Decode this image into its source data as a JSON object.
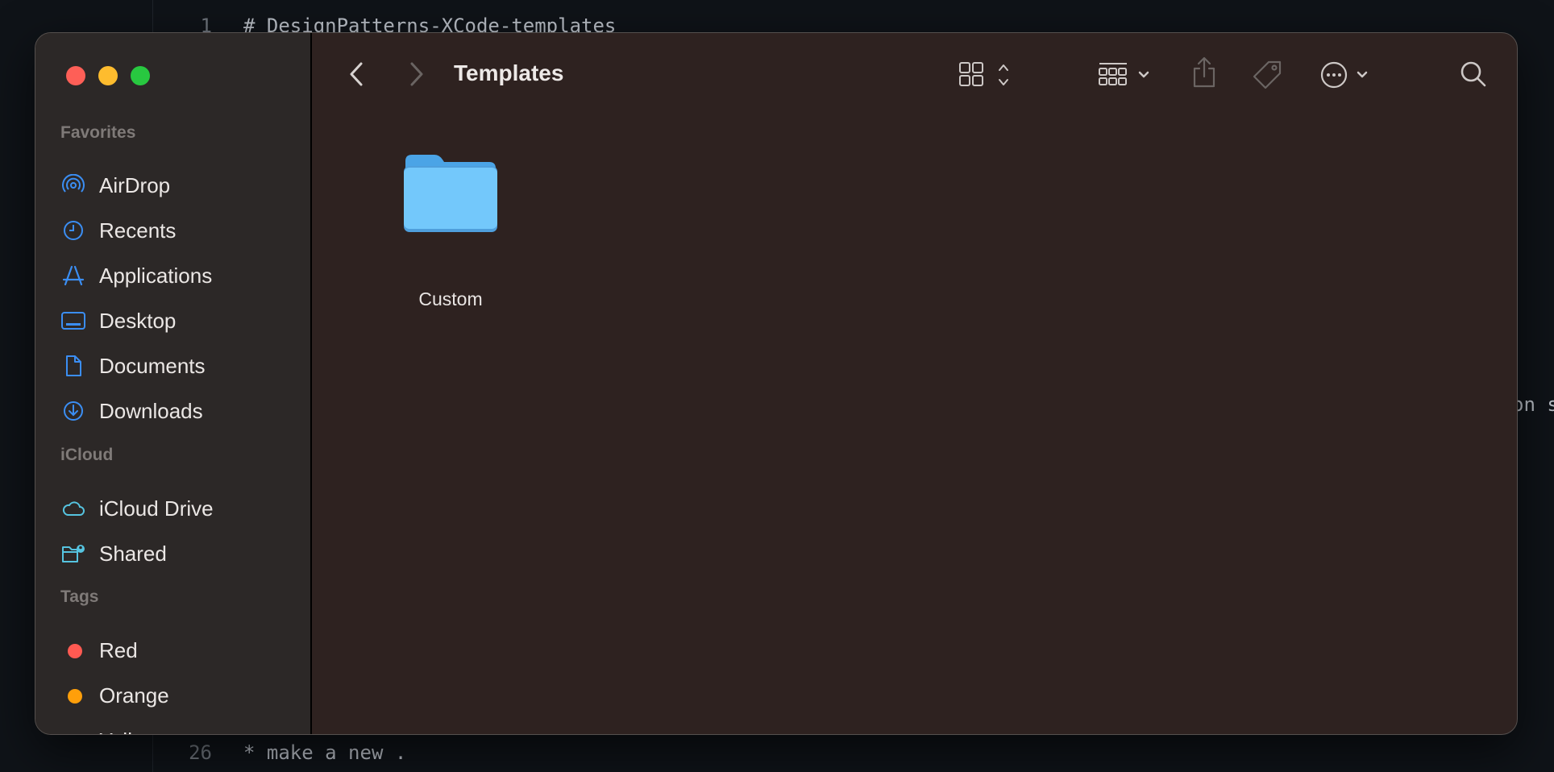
{
  "editor": {
    "lines": [
      {
        "num": "1",
        "text": "# DesignPatterns-XCode-templates"
      },
      {
        "num": "26",
        "text": "* make a new ."
      }
    ],
    "overflow_text": "on s"
  },
  "window": {
    "title": "Templates"
  },
  "sidebar": {
    "sections": [
      {
        "label": "Favorites"
      },
      {
        "label": "iCloud"
      },
      {
        "label": "Tags"
      }
    ],
    "favorites": [
      {
        "label": "AirDrop",
        "icon": "airdrop-icon"
      },
      {
        "label": "Recents",
        "icon": "clock-icon"
      },
      {
        "label": "Applications",
        "icon": "applications-icon"
      },
      {
        "label": "Desktop",
        "icon": "desktop-icon"
      },
      {
        "label": "Documents",
        "icon": "document-icon"
      },
      {
        "label": "Downloads",
        "icon": "download-icon"
      }
    ],
    "icloud": [
      {
        "label": "iCloud Drive",
        "icon": "cloud-icon"
      },
      {
        "label": "Shared",
        "icon": "shared-folder-icon"
      }
    ],
    "tags": [
      {
        "label": "Red",
        "color": "#ff5a52"
      },
      {
        "label": "Orange",
        "color": "#ff9f0a"
      },
      {
        "label": "Yellow",
        "color": "#ffd60a"
      }
    ]
  },
  "content": {
    "items": [
      {
        "label": "Custom",
        "icon": "folder-icon"
      }
    ]
  },
  "colors": {
    "accent": "#3b8ef3",
    "icloud_accent": "#56c4e0",
    "folder": "#6ec6fb"
  }
}
